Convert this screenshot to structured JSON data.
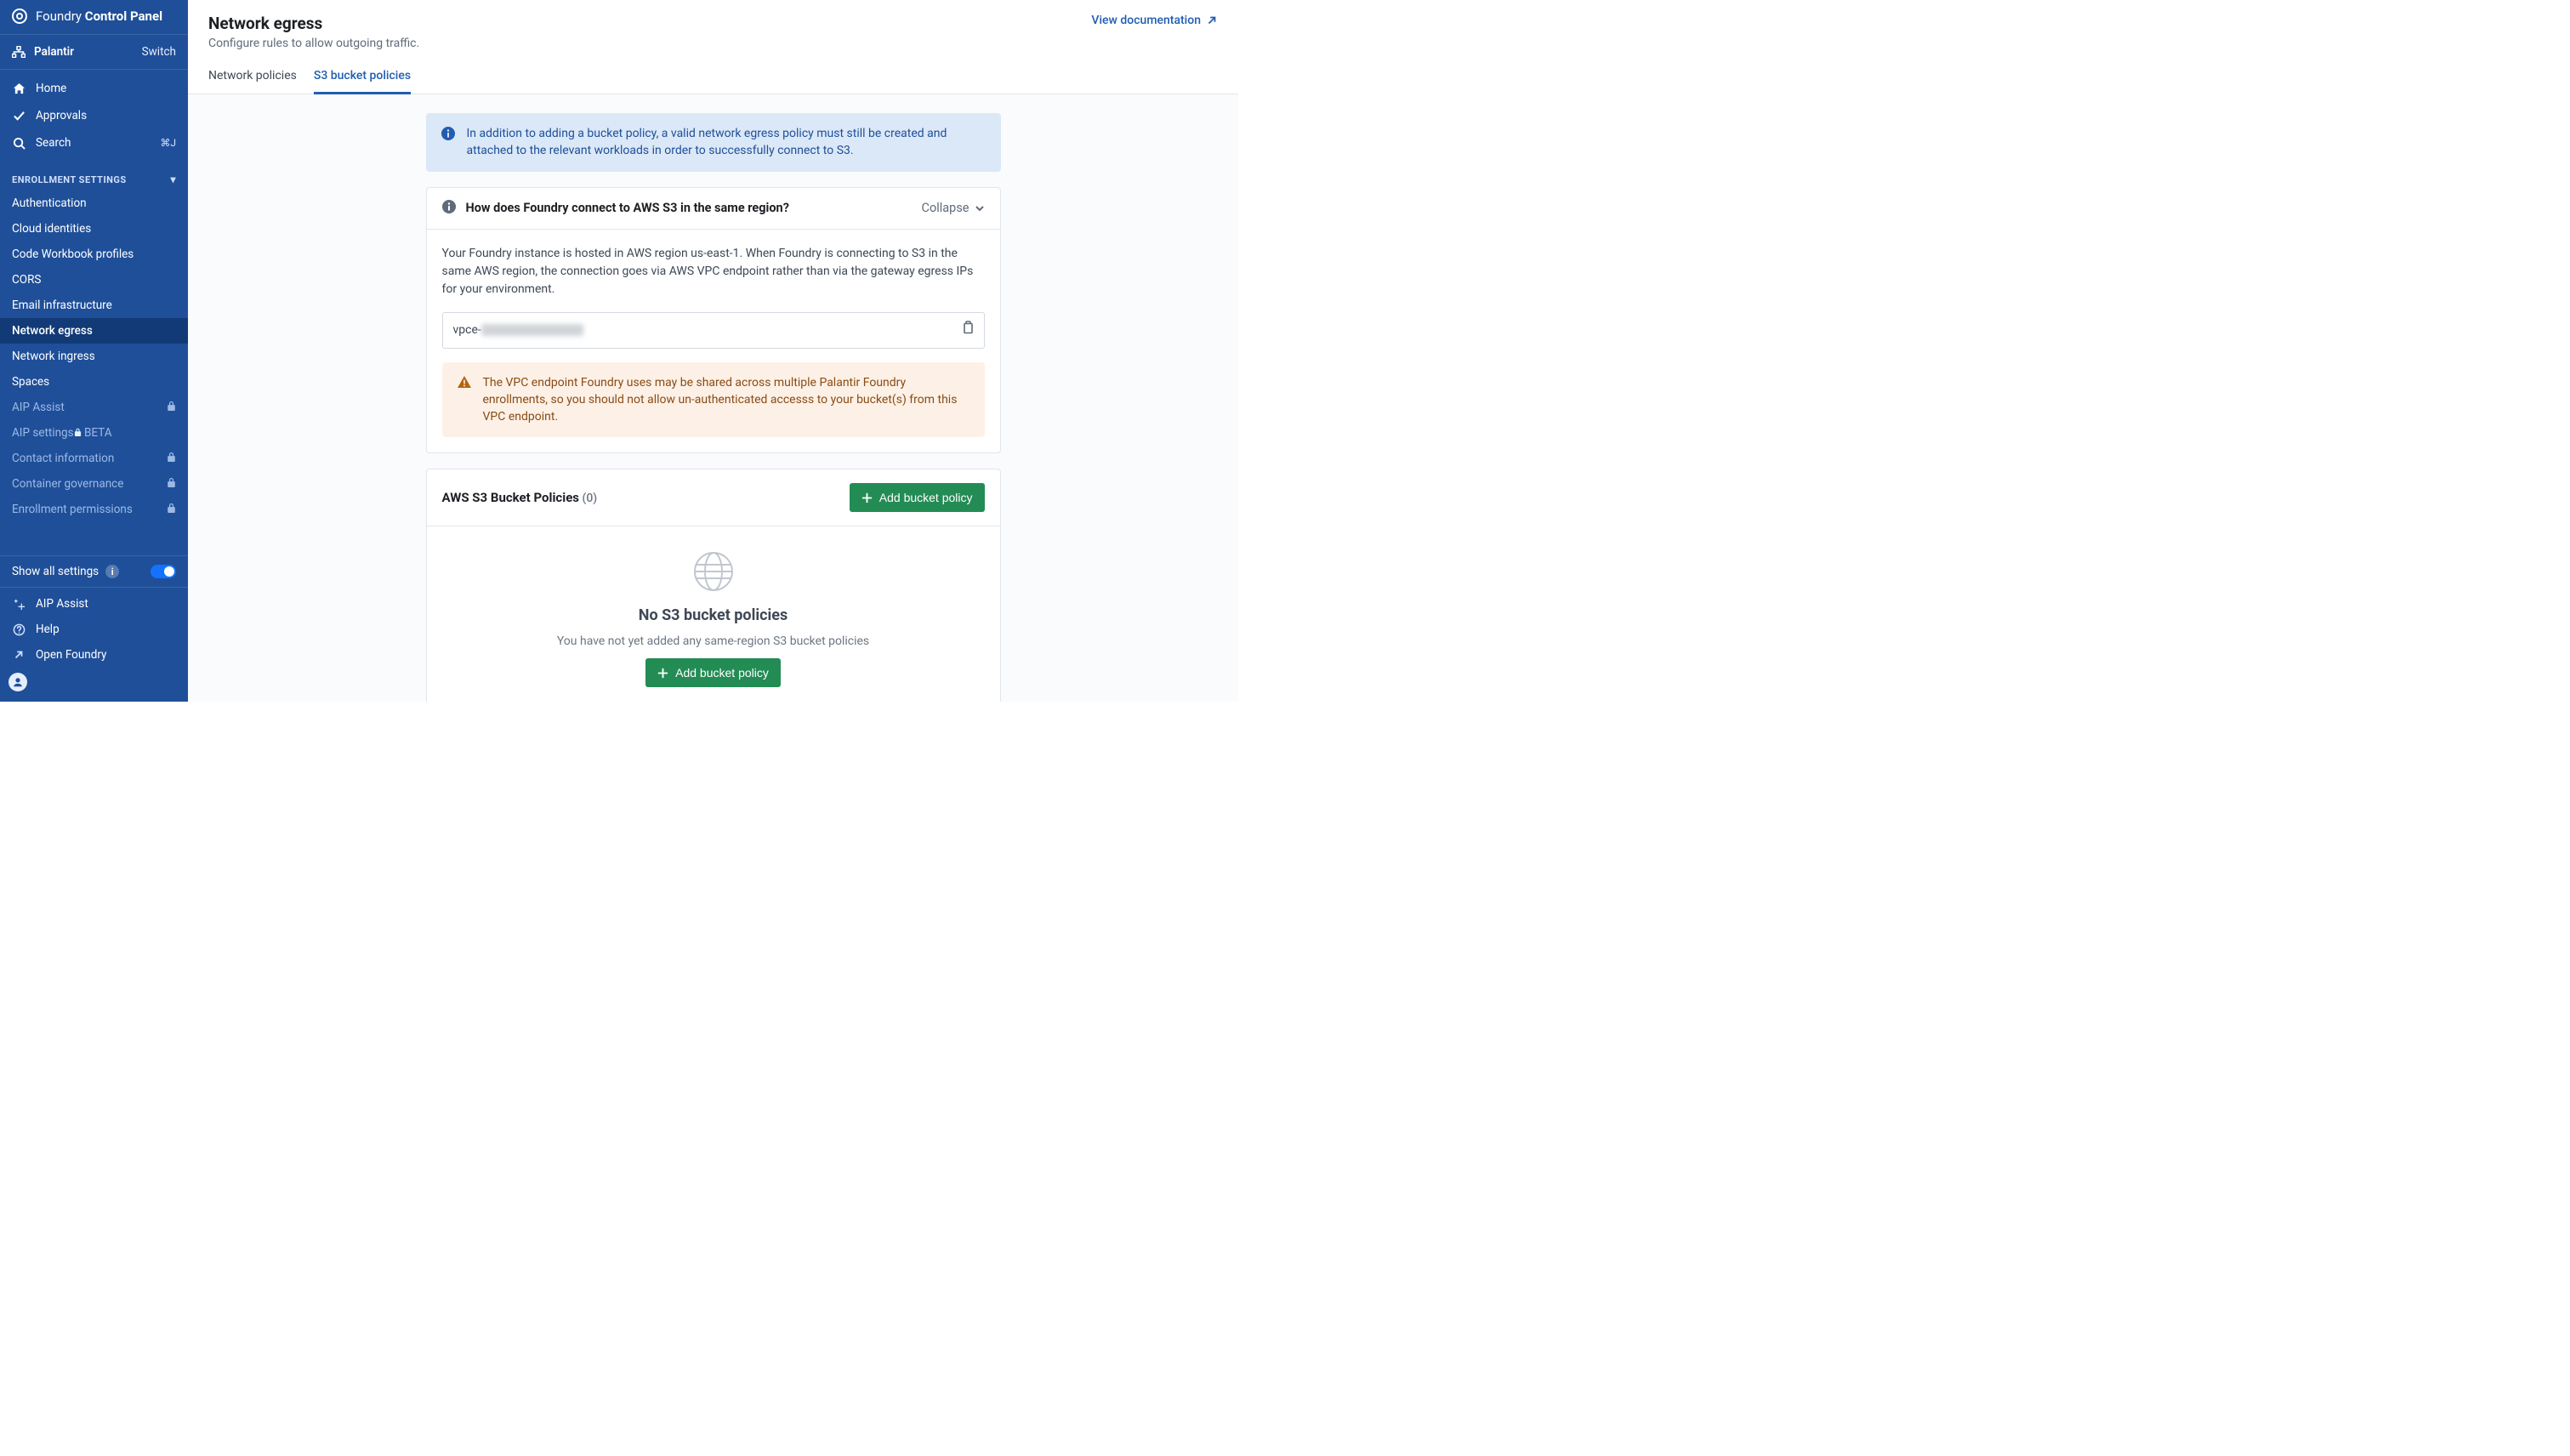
{
  "brand": {
    "light": "Foundry ",
    "bold": "Control Panel"
  },
  "org": {
    "name": "Palantir",
    "switch": "Switch"
  },
  "nav_primary": [
    {
      "key": "home",
      "label": "Home",
      "icon": "home"
    },
    {
      "key": "approvals",
      "label": "Approvals",
      "icon": "check"
    },
    {
      "key": "search",
      "label": "Search",
      "icon": "search",
      "kbd": "⌘J"
    }
  ],
  "enrollment_section": {
    "label": "ENROLLMENT SETTINGS",
    "items": [
      {
        "key": "authentication",
        "label": "Authentication"
      },
      {
        "key": "cloud_identities",
        "label": "Cloud identities"
      },
      {
        "key": "code_workbook_profiles",
        "label": "Code Workbook profiles"
      },
      {
        "key": "cors",
        "label": "CORS"
      },
      {
        "key": "email_infrastructure",
        "label": "Email infrastructure"
      },
      {
        "key": "network_egress",
        "label": "Network egress",
        "active": true
      },
      {
        "key": "network_ingress",
        "label": "Network ingress"
      },
      {
        "key": "spaces",
        "label": "Spaces"
      },
      {
        "key": "aip_assist",
        "label": "AIP Assist",
        "locked": true
      },
      {
        "key": "aip_settings",
        "label": "AIP settings",
        "locked": true,
        "beta": "BETA"
      },
      {
        "key": "contact_information",
        "label": "Contact information",
        "locked": true
      },
      {
        "key": "container_governance",
        "label": "Container governance",
        "locked": true
      },
      {
        "key": "enrollment_permissions",
        "label": "Enrollment permissions",
        "locked": true
      }
    ]
  },
  "sidebar_cut_hint": "",
  "show_all": {
    "label": "Show all settings"
  },
  "sidebar_footer": [
    {
      "key": "aip_assist_footer",
      "label": "AIP Assist",
      "icon": "sparkles"
    },
    {
      "key": "help",
      "label": "Help",
      "icon": "help"
    },
    {
      "key": "open_foundry",
      "label": "Open Foundry",
      "icon": "open"
    }
  ],
  "page": {
    "title": "Network egress",
    "subtitle": "Configure rules to allow outgoing traffic.",
    "doc_link": "View documentation"
  },
  "tabs": [
    {
      "key": "network_policies",
      "label": "Network policies",
      "active": false
    },
    {
      "key": "s3_bucket_policies",
      "label": "S3 bucket policies",
      "active": true
    }
  ],
  "info_callout": "In addition to adding a bucket policy, a valid network egress policy must still be created and attached to the relevant workloads in order to successfully connect to S3.",
  "connect_panel": {
    "heading": "How does Foundry connect to AWS S3 in the same region?",
    "collapse_label": "Collapse",
    "body_text": "Your Foundry instance is hosted in AWS region us-east-1. When Foundry is connecting to S3 in the same AWS region, the connection goes via AWS VPC endpoint rather than via the gateway egress IPs for your environment.",
    "endpoint_prefix": "vpce-",
    "warn_text": "The VPC endpoint Foundry uses may be shared across multiple Palantir Foundry enrollments, so you should not allow un-authenticated accesss to your bucket(s) from this VPC endpoint."
  },
  "policies_panel": {
    "title": "AWS S3 Bucket Policies",
    "count_label": "(0)",
    "add_button": "Add bucket policy",
    "empty_title": "No S3 bucket policies",
    "empty_subtitle": "You have not yet added any same-region S3 bucket policies",
    "empty_button": "Add bucket policy"
  }
}
